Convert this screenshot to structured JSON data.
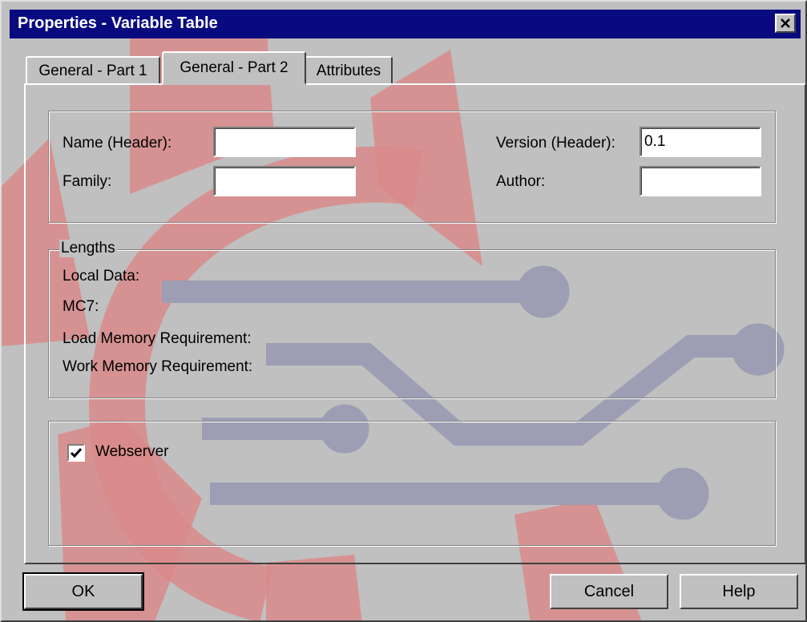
{
  "window": {
    "title": "Properties - Variable Table",
    "close_icon": "close-icon"
  },
  "tabs": [
    {
      "label": "General - Part 1",
      "active": false
    },
    {
      "label": "General - Part 2",
      "active": true
    },
    {
      "label": "Attributes",
      "active": false
    }
  ],
  "header": {
    "name_label": "Name (Header):",
    "name_value": "",
    "family_label": "Family:",
    "family_value": "",
    "version_label": "Version (Header):",
    "version_value": "0.1",
    "author_label": "Author:",
    "author_value": ""
  },
  "lengths": {
    "legend": "Lengths",
    "local_data": "Local Data:",
    "mc7": "MC7:",
    "load_memory": "Load Memory Requirement:",
    "work_memory": "Work Memory Requirement:"
  },
  "options": {
    "webserver_label": "Webserver",
    "webserver_checked": true
  },
  "buttons": {
    "ok": "OK",
    "cancel": "Cancel",
    "help": "Help"
  }
}
